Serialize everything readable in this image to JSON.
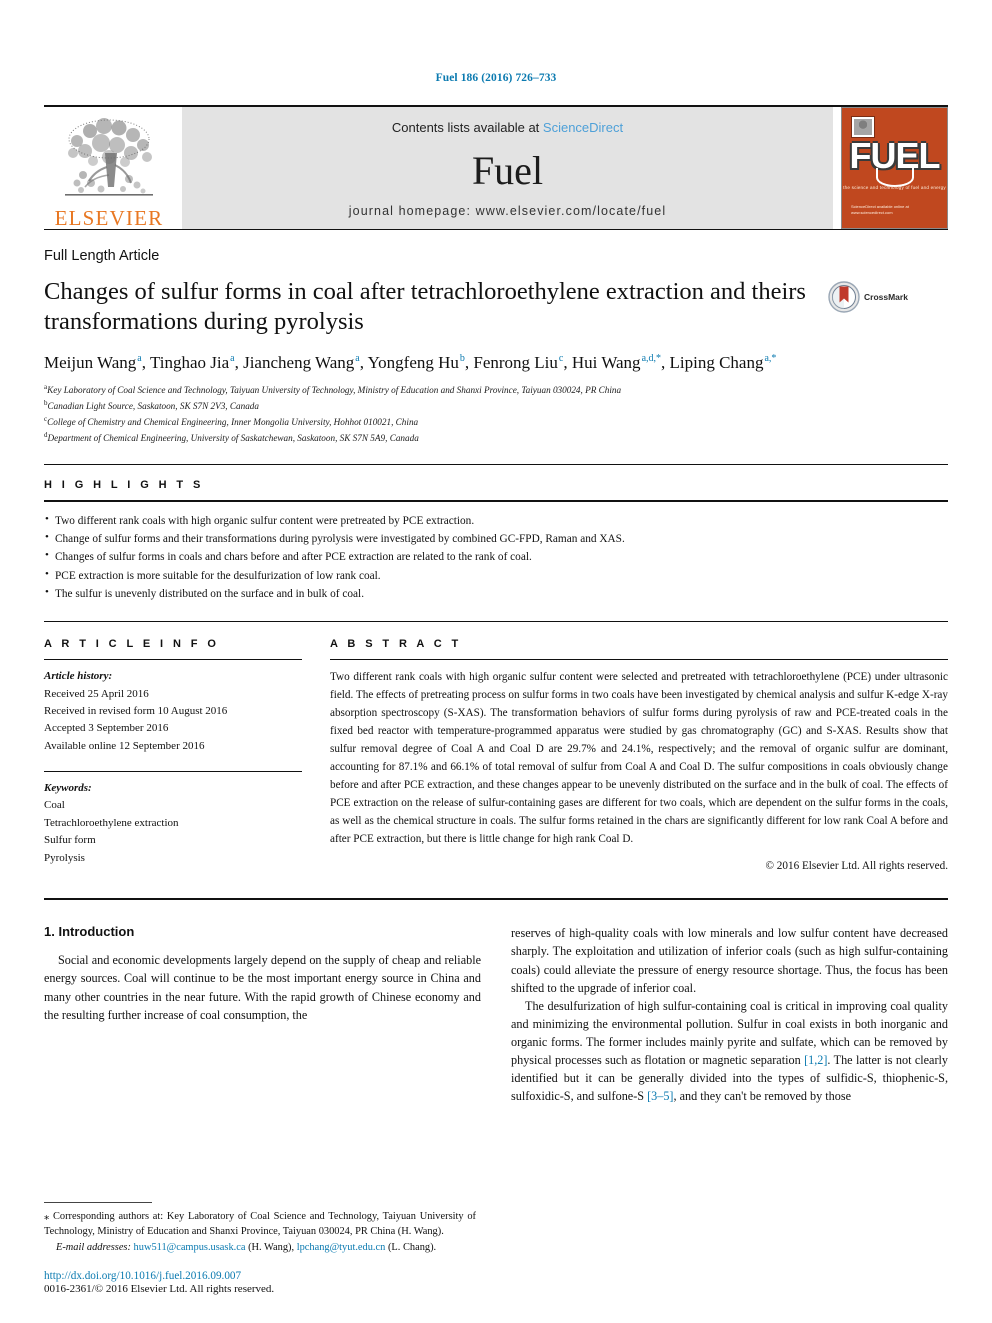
{
  "running_head": "Fuel 186 (2016) 726–733",
  "masthead": {
    "publisher_name": "ELSEVIER",
    "contents_prefix": "Contents lists available at ",
    "contents_link": "ScienceDirect",
    "journal_name": "Fuel",
    "homepage": "journal homepage: www.elsevier.com/locate/fuel",
    "cover": {
      "title": "FUEL",
      "subtitle": "the science and technology of fuel and energy",
      "bottom_line1": "ScienceDirect available online at",
      "bottom_line2": "www.sciencedirect.com"
    }
  },
  "article": {
    "type": "Full Length Article",
    "title": "Changes of sulfur forms in coal after tetrachloroethylene extraction and theirs transformations during pyrolysis",
    "crossmark_label": "CrossMark",
    "authors": [
      {
        "name": "Meijun Wang",
        "sup": "a"
      },
      {
        "name": "Tinghao Jia",
        "sup": "a"
      },
      {
        "name": "Jiancheng Wang",
        "sup": "a"
      },
      {
        "name": "Yongfeng Hu",
        "sup": "b"
      },
      {
        "name": "Fenrong Liu",
        "sup": "c"
      },
      {
        "name": "Hui Wang",
        "sup": "a,d,*"
      },
      {
        "name": "Liping Chang",
        "sup": "a,*"
      }
    ],
    "affiliations": [
      {
        "marker": "a",
        "text": "Key Laboratory of Coal Science and Technology, Taiyuan University of Technology, Ministry of Education and Shanxi Province, Taiyuan 030024, PR China"
      },
      {
        "marker": "b",
        "text": "Canadian Light Source, Saskatoon, SK S7N 2V3, Canada"
      },
      {
        "marker": "c",
        "text": "College of Chemistry and Chemical Engineering, Inner Mongolia University, Hohhot 010021, China"
      },
      {
        "marker": "d",
        "text": "Department of Chemical Engineering, University of Saskatchewan, Saskatoon, SK S7N 5A9, Canada"
      }
    ]
  },
  "highlights": {
    "label": "H I G H L I G H T S",
    "items": [
      "Two different rank coals with high organic sulfur content were pretreated by PCE extraction.",
      "Change of sulfur forms and their transformations during pyrolysis were investigated by combined GC-FPD, Raman and XAS.",
      "Changes of sulfur forms in coals and chars before and after PCE extraction are related to the rank of coal.",
      "PCE extraction is more suitable for the desulfurization of low rank coal.",
      "The sulfur is unevenly distributed on the surface and in bulk of coal."
    ]
  },
  "article_info": {
    "label": "A R T I C L E   I N F O",
    "history_label": "Article history:",
    "history": [
      "Received 25 April 2016",
      "Received in revised form 10 August 2016",
      "Accepted 3 September 2016",
      "Available online 12 September 2016"
    ],
    "keywords_label": "Keywords:",
    "keywords": [
      "Coal",
      "Tetrachloroethylene extraction",
      "Sulfur form",
      "Pyrolysis"
    ]
  },
  "abstract": {
    "label": "A B S T R A C T",
    "text": "Two different rank coals with high organic sulfur content were selected and pretreated with tetrachloroethylene (PCE) under ultrasonic field. The effects of pretreating process on sulfur forms in two coals have been investigated by chemical analysis and sulfur K-edge X-ray absorption spectroscopy (S-XAS). The transformation behaviors of sulfur forms during pyrolysis of raw and PCE-treated coals in the fixed bed reactor with temperature-programmed apparatus were studied by gas chromatography (GC) and S-XAS. Results show that sulfur removal degree of Coal A and Coal D are 29.7% and 24.1%, respectively; and the removal of organic sulfur are dominant, accounting for 87.1% and 66.1% of total removal of sulfur from Coal A and Coal D. The sulfur compositions in coals obviously change before and after PCE extraction, and these changes appear to be unevenly distributed on the surface and in the bulk of coal. The effects of PCE extraction on the release of sulfur-containing gases are different for two coals, which are dependent on the sulfur forms in the coals, as well as the chemical structure in coals. The sulfur forms retained in the chars are significantly different for low rank Coal A before and after PCE extraction, but there is little change for high rank Coal D.",
    "copyright": "© 2016 Elsevier Ltd. All rights reserved."
  },
  "introduction": {
    "heading": "1. Introduction",
    "left_paragraph": "Social and economic developments largely depend on the supply of cheap and reliable energy sources. Coal will continue to be the most important energy source in China and many other countries in the near future. With the rapid growth of Chinese economy and the resulting further increase of coal consumption, the",
    "right_paragraph_1": "reserves of high-quality coals with low minerals and low sulfur content have decreased sharply. The exploitation and utilization of inferior coals (such as high sulfur-containing coals) could alleviate the pressure of energy resource shortage. Thus, the focus has been shifted to the upgrade of inferior coal.",
    "right_paragraph_2_a": "The desulfurization of high sulfur-containing coal is critical in improving coal quality and minimizing the environmental pollution. Sulfur in coal exists in both inorganic and organic forms. The former includes mainly pyrite and sulfate, which can be removed by physical processes such as flotation or magnetic separation ",
    "right_ref_1": "[1,2]",
    "right_paragraph_2_b": ". The latter is not clearly identified but it can be generally divided into the types of sulfidic-S, thiophenic-S, sulfoxidic-S, and sulfone-S ",
    "right_ref_2": "[3–5]",
    "right_paragraph_2_c": ", and they can't be removed by those"
  },
  "footnote": {
    "corresponding": "⁎ Corresponding authors at: Key Laboratory of Coal Science and Technology, Taiyuan University of Technology, Ministry of Education and Shanxi Province, Taiyuan 030024, PR China (H. Wang).",
    "email_label": "E-mail addresses:",
    "email_1": "huw511@campus.usask.ca",
    "email_1_owner": "(H. Wang),",
    "email_2": "lpchang@tyut.edu.cn",
    "email_2_owner": "(L. Chang).",
    "doi": "http://dx.doi.org/10.1016/j.fuel.2016.09.007",
    "issn": "0016-2361/© 2016 Elsevier Ltd. All rights reserved."
  },
  "colors": {
    "link": "#0b7ab0",
    "elsevier_orange": "#e87722",
    "sciencedirect": "#4ea0d8",
    "cover_red": "#c0481f"
  }
}
